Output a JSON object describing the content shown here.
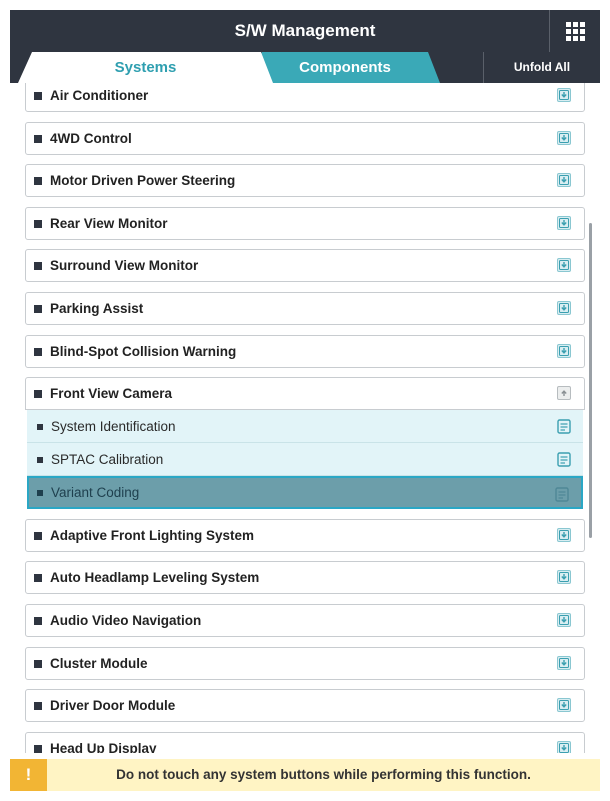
{
  "header": {
    "title": "S/W Management",
    "menu_icon": "grid-icon"
  },
  "tabs": {
    "systems": "Systems",
    "components": "Components",
    "unfold_all": "Unfold All"
  },
  "systems": [
    {
      "label": "Air Conditioner",
      "icon": "download-icon"
    },
    {
      "label": "4WD Control",
      "icon": "download-icon"
    },
    {
      "label": "Motor Driven Power Steering",
      "icon": "download-icon"
    },
    {
      "label": "Rear View Monitor",
      "icon": "download-icon"
    },
    {
      "label": "Surround View Monitor",
      "icon": "download-icon"
    },
    {
      "label": "Parking Assist",
      "icon": "download-icon"
    },
    {
      "label": "Blind-Spot Collision Warning",
      "icon": "download-icon"
    },
    {
      "label": "Front View Camera",
      "icon": "collapse-icon",
      "expanded": true,
      "children": [
        {
          "label": "System Identification",
          "icon": "document-icon"
        },
        {
          "label": "SPTAC Calibration",
          "icon": "document-icon"
        },
        {
          "label": "Variant Coding",
          "icon": "document-icon",
          "selected": true
        }
      ]
    },
    {
      "label": "Adaptive Front Lighting System",
      "icon": "download-icon"
    },
    {
      "label": "Auto Headlamp Leveling System",
      "icon": "download-icon"
    },
    {
      "label": "Audio Video Navigation",
      "icon": "download-icon"
    },
    {
      "label": "Cluster Module",
      "icon": "download-icon"
    },
    {
      "label": "Driver Door Module",
      "icon": "download-icon"
    },
    {
      "label": "Head Up Display",
      "icon": "download-icon"
    }
  ],
  "warning": {
    "badge": "!",
    "text": "Do not touch any system buttons while performing this function."
  },
  "colors": {
    "header_bg": "#2f3540",
    "accent": "#3aa9b7",
    "selected_row": "#6c9eaa",
    "warning_bg": "#fff4c4",
    "warning_badge": "#f2b534"
  }
}
